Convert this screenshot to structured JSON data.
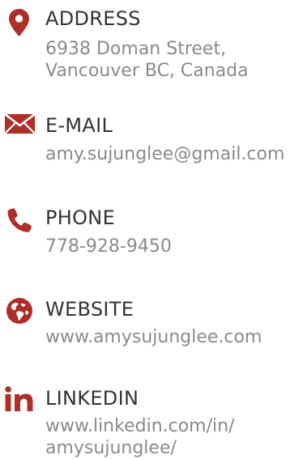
{
  "theme": {
    "accent": "#b02e2a",
    "heading_color": "#333333",
    "text_color": "#8a8a8a"
  },
  "address": {
    "icon": "map-pin-icon",
    "heading": "ADDRESS",
    "line1": "6938 Doman Street,",
    "line2": "Vancouver BC, Canada"
  },
  "email": {
    "icon": "envelope-icon",
    "heading": "E-MAIL",
    "value": "amy.sujunglee@gmail.com"
  },
  "phone": {
    "icon": "phone-icon",
    "heading": "PHONE",
    "value": "778-928-9450"
  },
  "website": {
    "icon": "globe-icon",
    "heading": "WEBSITE",
    "value": "www.amysujunglee.com"
  },
  "linkedin": {
    "icon": "linkedin-icon",
    "heading": "LINKEDIN",
    "line1": "www.linkedin.com/in/",
    "line2": "amysujunglee/"
  }
}
